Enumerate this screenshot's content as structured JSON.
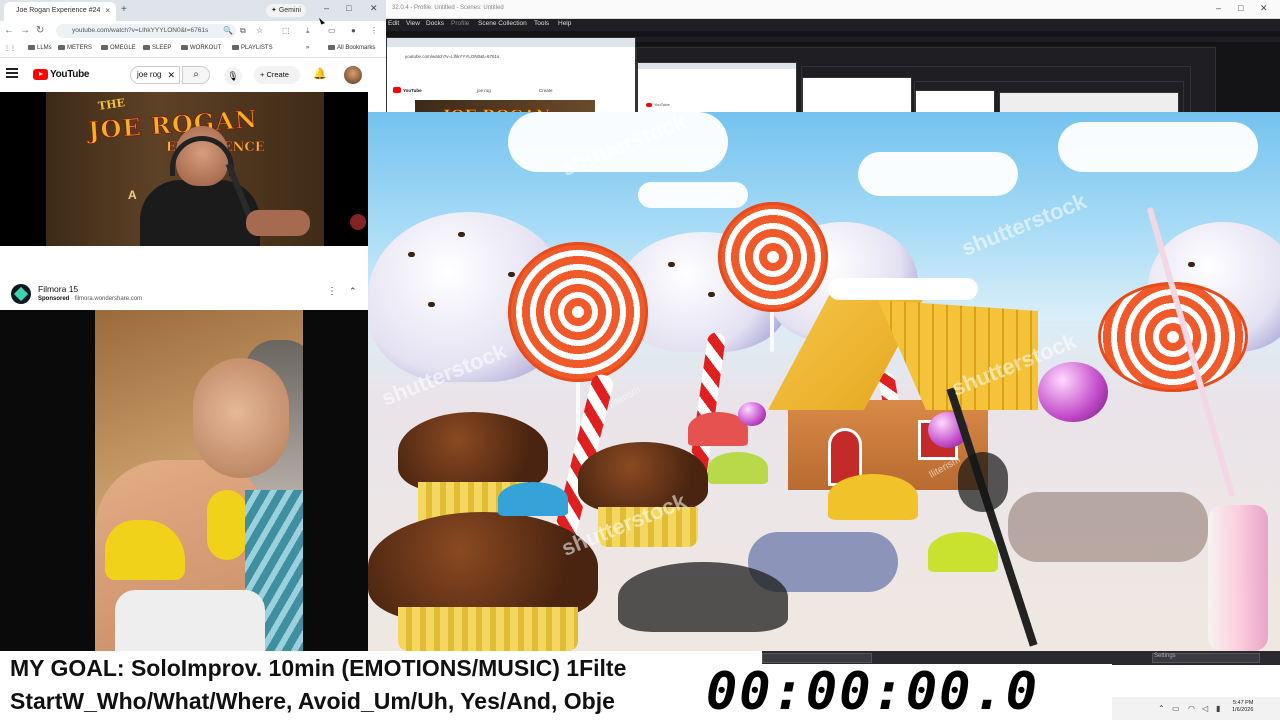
{
  "chrome": {
    "tab_title": "Joe Rogan Experience #24",
    "tab_close": "×",
    "new_tab": "+",
    "gemini_label": "Gemini",
    "url": "youtube.com/watch?v=LlhkYYYLON0&t=6761s",
    "bookmarks": [
      "LLMs",
      "METERS",
      "OMEGLE",
      "SLEEP",
      "WORKOUT",
      "PLAYLISTS"
    ],
    "all_bookmarks": "All Bookmarks"
  },
  "youtube": {
    "logo_text": "YouTube",
    "search_query": "joe rog",
    "create_label": "Create",
    "video_sign_top": "THE",
    "video_sign_main": "JOE ROGAN",
    "video_sign_bottom": "EXPERIENCE",
    "video_sign_letter": "A"
  },
  "ad": {
    "title": "Filmora 15",
    "sponsored": "Sponsored",
    "domain": "filmora.wondershare.com"
  },
  "obs": {
    "title": "32.0.4 - Profile: Untitled - Scenes: Untitled",
    "menu": [
      "Edit",
      "View",
      "Docks",
      "Profile",
      "Scene Collection",
      "Tools",
      "Help"
    ],
    "dock_settings": "Settings",
    "mini_logo_text": "YouTube",
    "mini_search": "joe rog",
    "mini_create": "Create"
  },
  "scene": {
    "watermark": "shutterstock",
    "watermark_small": "lliterism"
  },
  "overlay": {
    "goal_line1": "MY GOAL: SoloImprov. 10min (EMOTIONS/MUSIC) 1Filte",
    "goal_line2": "StartW_Who/What/Where, Avoid_Um/Uh, Yes/And, Obje",
    "timer": "00:00:00.0"
  },
  "taskbar": {
    "time": "5:47 PM",
    "date": "1/6/2026"
  },
  "colors": {
    "youtube_red": "#ff0000",
    "obs_dark": "#1f1f23",
    "sky": "#74c2ef"
  }
}
